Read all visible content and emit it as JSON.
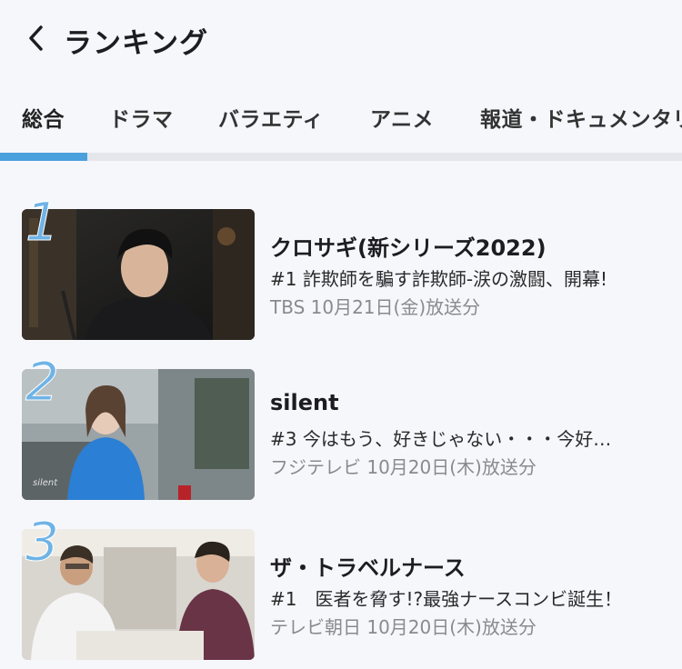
{
  "header": {
    "title": "ランキング",
    "back_icon": "chevron-left-icon"
  },
  "tabs": [
    {
      "label": "総合",
      "active": true
    },
    {
      "label": "ドラマ",
      "active": false
    },
    {
      "label": "バラエティ",
      "active": false
    },
    {
      "label": "アニメ",
      "active": false
    },
    {
      "label": "報道・ドキュメンタリ",
      "active": false
    }
  ],
  "colors": {
    "accent": "#4aa0dc",
    "rank_number": "#6fb3e6",
    "background": "#f6f7fb",
    "meta_text": "#8a8a8e"
  },
  "ranking": [
    {
      "rank": "1",
      "title": "クロサギ(新シリーズ2022)",
      "episode": "#1 詐欺師を騙す詐欺師-涙の激闘、開幕!",
      "meta": "TBS 10月21日(金)放送分"
    },
    {
      "rank": "2",
      "title": "silent",
      "episode": "#3 今はもう、好きじゃない・・・今好…",
      "meta": "フジテレビ 10月20日(木)放送分"
    },
    {
      "rank": "3",
      "title": "ザ・トラベルナース",
      "episode": "#1　医者を脅す!?最強ナースコンビ誕生！",
      "meta": "テレビ朝日 10月20日(木)放送分"
    }
  ]
}
